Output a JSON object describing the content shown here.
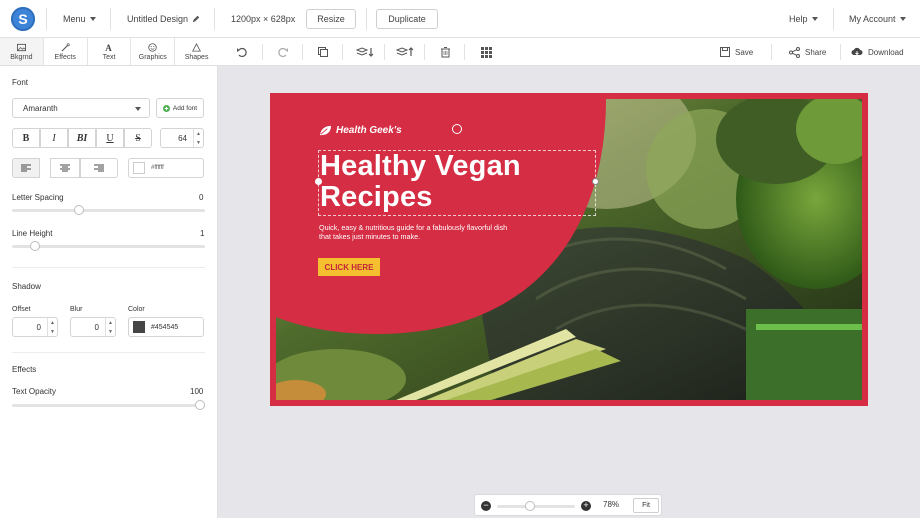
{
  "topbar": {
    "logo_letter": "S",
    "menu_label": "Menu",
    "design_title": "Untitled Design",
    "dimensions": "1200px × 628px",
    "resize_label": "Resize",
    "duplicate_label": "Duplicate",
    "help_label": "Help",
    "account_label": "My Account"
  },
  "tabs": [
    {
      "label": "Bkgrnd",
      "icon": "image-icon"
    },
    {
      "label": "Effects",
      "icon": "magic-wand-icon"
    },
    {
      "label": "Text",
      "icon": "text-icon"
    },
    {
      "label": "Graphics",
      "icon": "smiley-icon"
    },
    {
      "label": "Shapes",
      "icon": "triangle-icon"
    }
  ],
  "toolbar": {
    "save_label": "Save",
    "share_label": "Share",
    "download_label": "Download"
  },
  "panel": {
    "font_title": "Font",
    "font_name": "Amaranth",
    "add_font_label": "Add font",
    "format_buttons": [
      "B",
      "I",
      "BI",
      "U",
      "S"
    ],
    "font_size": "64",
    "color_hex": "#ffffff",
    "letter_spacing_label": "Letter Spacing",
    "letter_spacing_value": "0",
    "letter_spacing_fraction": 0.34,
    "line_height_label": "Line Height",
    "line_height_value": "1",
    "line_height_fraction": 0.1,
    "shadow_title": "Shadow",
    "offset_label": "Offset",
    "offset_value": "0",
    "blur_label": "Blur",
    "blur_value": "0",
    "shadow_color_label": "Color",
    "shadow_color_hex": "#454545",
    "effects_title": "Effects",
    "opacity_label": "Text Opacity",
    "opacity_value": "100",
    "opacity_fraction": 1.0
  },
  "design": {
    "brand": "Health Geek's",
    "headline_1": "Healthy Vegan",
    "headline_2": "Recipes",
    "body": "Quick, easy & nutritious guide for a fabulously flavorful dish that takes just minutes to make.",
    "cta_label": "CLICK HERE",
    "accent_color": "#d42d44",
    "cta_color": "#f5c030"
  },
  "zoom": {
    "value": "78%",
    "fit_label": "Fit"
  }
}
